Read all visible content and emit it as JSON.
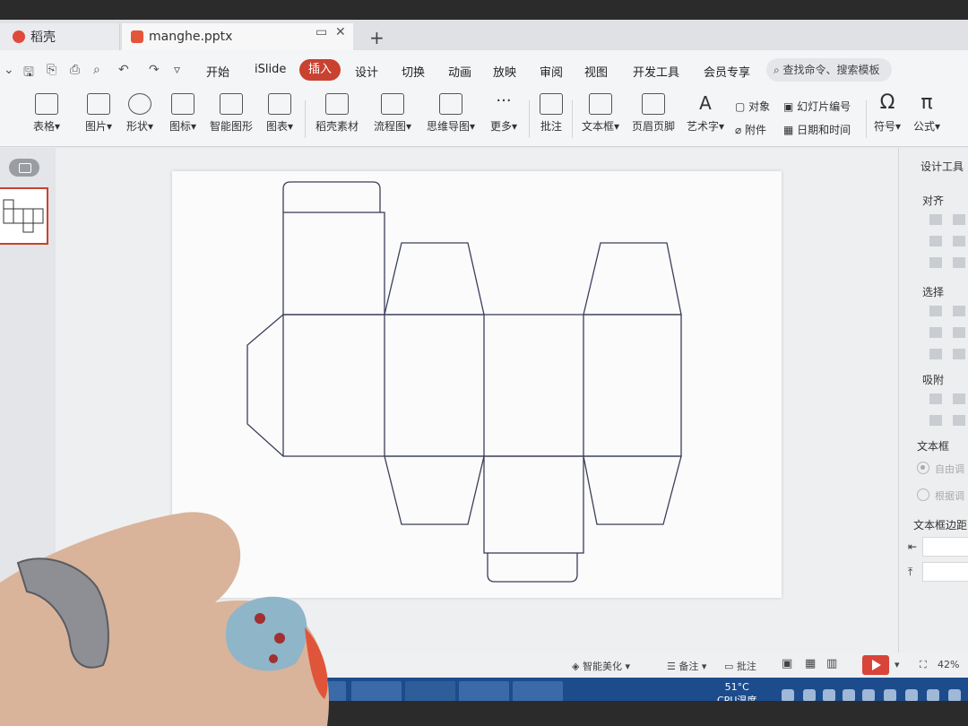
{
  "tabs": [
    {
      "label": "稻壳"
    },
    {
      "label": "manghe.pptx"
    }
  ],
  "tab_controls": {
    "new_tab": "+",
    "close": "✕"
  },
  "menu": {
    "items": [
      "开始",
      "iSlide",
      "插入",
      "设计",
      "切换",
      "动画",
      "放映",
      "审阅",
      "视图",
      "开发工具",
      "会员专享"
    ],
    "active": "插入",
    "search_placeholder": "查找命令、搜索模板"
  },
  "ribbon": {
    "table": "表格",
    "picture": "图片",
    "shape": "形状",
    "icon": "图标",
    "smart_shape": "智能图形",
    "chart": "图表",
    "docer_material": "稻壳素材",
    "flowchart": "流程图",
    "mindmap": "思维导图",
    "more": "更多",
    "comment": "批注",
    "textbox": "文本框",
    "header_footer": "页眉页脚",
    "wordart": "艺术字",
    "object": "对象",
    "attachment": "附件",
    "slide_number": "幻灯片编号",
    "datetime": "日期和时间",
    "symbol": "符号",
    "formula": "公式"
  },
  "right_pane": {
    "title": "设计工具",
    "align": "对齐",
    "select": "选择",
    "snap": "吸附",
    "textbox": "文本框",
    "option_auto": "自由调",
    "option_fixed": "根据调",
    "textbox_margin": "文本框边距"
  },
  "status": {
    "smart_beautify": "智能美化",
    "notes": "备注",
    "comments": "批注",
    "zoom": "42%"
  },
  "taskbar": {
    "cpu_temp": "51°C",
    "cpu_label": "CPU温度"
  }
}
